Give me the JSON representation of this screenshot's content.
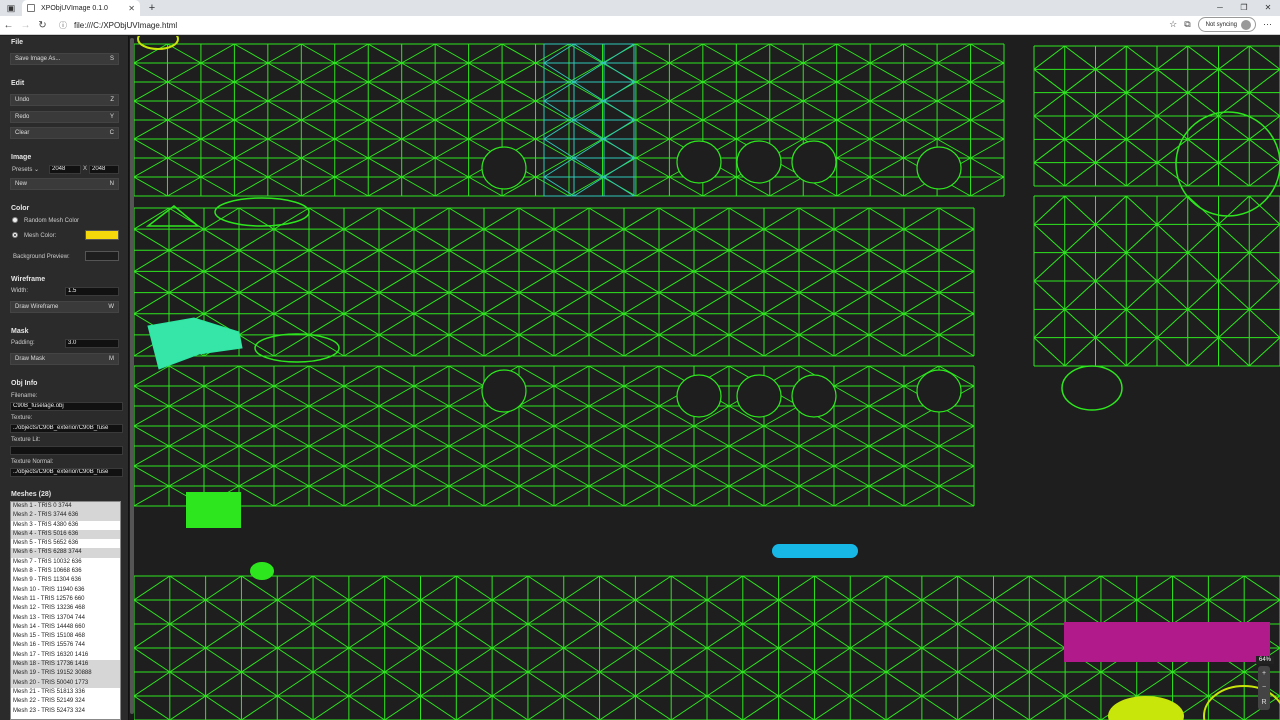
{
  "browser": {
    "tab_title": "XPObjUVImage 0.1.0",
    "url": "file:///C:/XPObjUVImage.html",
    "sync_label": "Not syncing"
  },
  "panel": {
    "file": {
      "title": "File",
      "save_label": "Save Image As...",
      "save_key": "S"
    },
    "edit": {
      "title": "Edit",
      "undo_label": "Undo",
      "undo_key": "Z",
      "redo_label": "Redo",
      "redo_key": "Y",
      "clear_label": "Clear",
      "clear_key": "C"
    },
    "image": {
      "title": "Image",
      "presets_label": "Presets",
      "width": "2048",
      "x_sep": "X",
      "height": "2048",
      "new_label": "New",
      "new_key": "N"
    },
    "color": {
      "title": "Color",
      "random_label": "Random Mesh Color",
      "mesh_label": "Mesh Color:",
      "mesh_color": "#f5d90a",
      "bg_label": "Background Preview:",
      "bg_color": "#1e1e1e"
    },
    "wireframe": {
      "title": "Wireframe",
      "width_label": "Width:",
      "width_value": "1.5",
      "draw_label": "Draw Wireframe",
      "draw_key": "W"
    },
    "mask": {
      "title": "Mask",
      "padding_label": "Padding:",
      "padding_value": "3.0",
      "draw_label": "Draw Mask",
      "draw_key": "M"
    },
    "objinfo": {
      "title": "Obj Info",
      "filename_label": "Filename:",
      "filename_value": "C90B_fuselage.obj",
      "texture_label": "Texture:",
      "texture_value": "../objects/C90B_exterior/C90B_fuse",
      "texture_lit_label": "Texture Lit:",
      "texture_lit_value": "",
      "texture_normal_label": "Texture Normal:",
      "texture_normal_value": "../objects/C90B_exterior/C90B_fuse"
    },
    "meshes": {
      "title": "Meshes (28)",
      "items": [
        "Mesh 1 - TRIS 0 3744",
        "Mesh 2 - TRIS 3744 636",
        "Mesh 3 - TRIS 4380 636",
        "Mesh 4 - TRIS 5016 636",
        "Mesh 5 - TRIS 5652 636",
        "Mesh 6 - TRIS 6288 3744",
        "Mesh 7 - TRIS 10032 636",
        "Mesh 8 - TRIS 10668 636",
        "Mesh 9 - TRIS 11304 636",
        "Mesh 10 - TRIS 11940 636",
        "Mesh 11 - TRIS 12576 660",
        "Mesh 12 - TRIS 13236 468",
        "Mesh 13 - TRIS 13704 744",
        "Mesh 14 - TRIS 14448 660",
        "Mesh 15 - TRIS 15108 468",
        "Mesh 16 - TRIS 15576 744",
        "Mesh 17 - TRIS 16320 1416",
        "Mesh 18 - TRIS 17736 1416",
        "Mesh 19 - TRIS 19152 30888",
        "Mesh 20 - TRIS 50040 1773",
        "Mesh 21 - TRIS 51813 336",
        "Mesh 22 - TRIS 52149 324",
        "Mesh 23 - TRIS 52473 324"
      ],
      "selected": [
        1,
        2,
        4,
        6,
        18,
        19,
        20
      ]
    }
  },
  "viewport": {
    "zoom": "64%",
    "wire_color": "#2ee61e"
  }
}
